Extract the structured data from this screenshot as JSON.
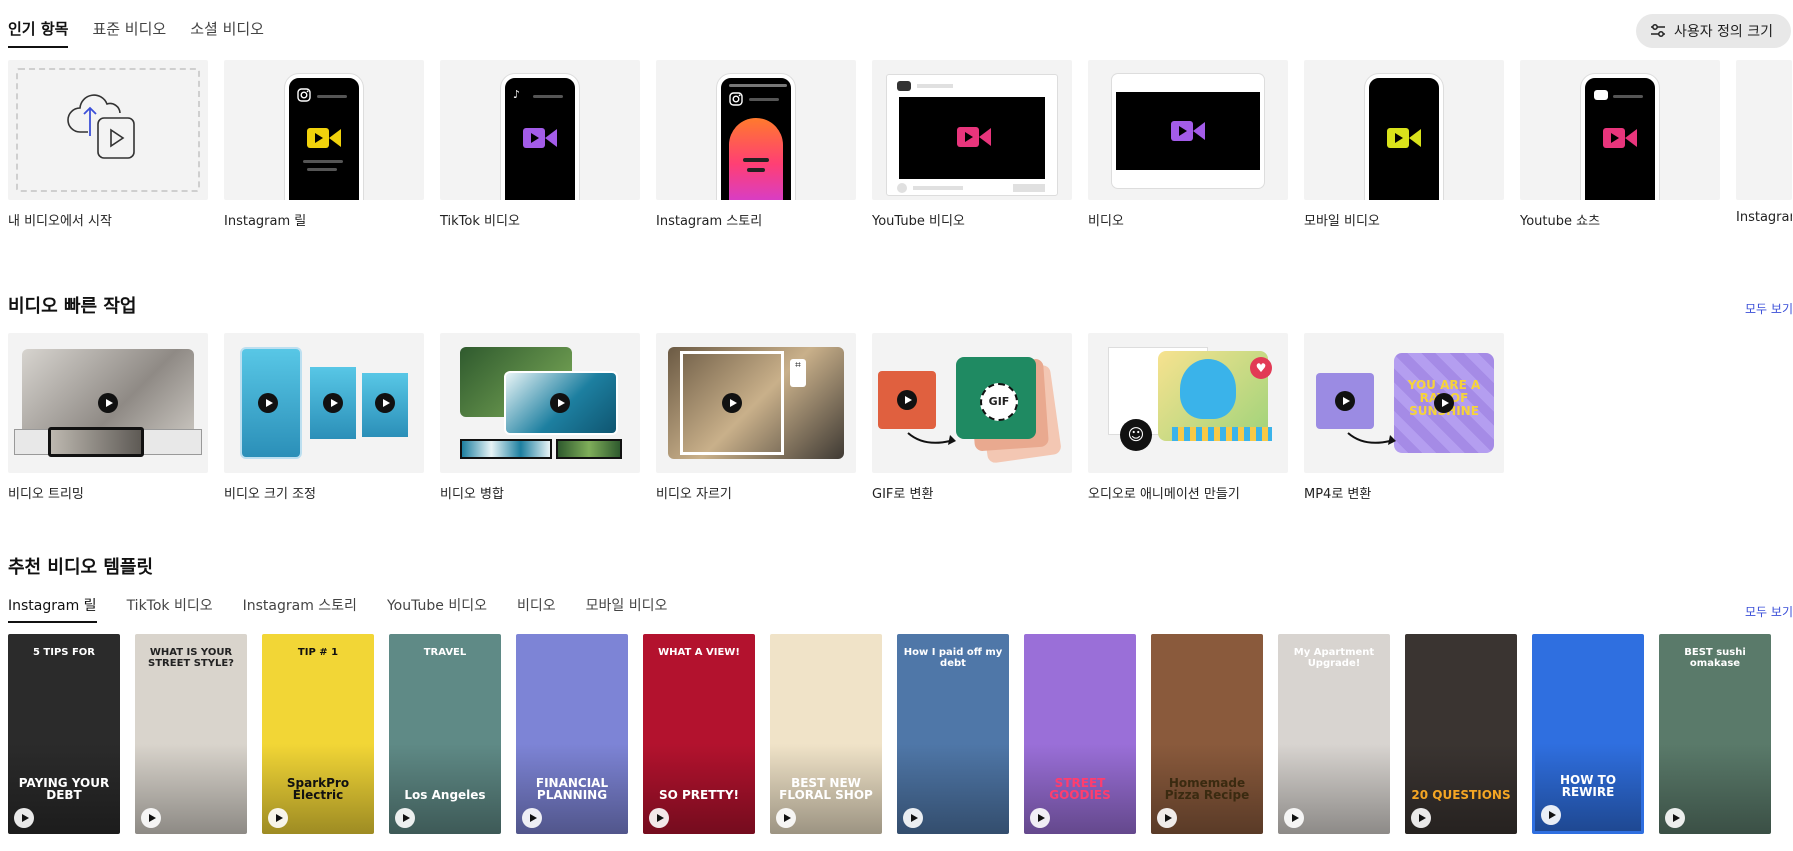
{
  "top_tabs": [
    {
      "label": "인기 항목",
      "active": true
    },
    {
      "label": "표준 비디오",
      "active": false
    },
    {
      "label": "소셜 비디오",
      "active": false
    }
  ],
  "custom_size_button": {
    "label": "사용자 정의 크기",
    "icon": "sliders-icon"
  },
  "formats": [
    {
      "label": "내 비디오에서 시작",
      "icon": "upload-video-icon"
    },
    {
      "label": "Instagram 릴",
      "icon": "instagram-icon",
      "accent": "#f1d20c"
    },
    {
      "label": "TikTok 비디오",
      "icon": "tiktok-icon",
      "accent": "#a35ce8"
    },
    {
      "label": "Instagram 스토리",
      "icon": "instagram-icon",
      "accent": "#ff5a4f"
    },
    {
      "label": "YouTube 비디오",
      "icon": "youtube-icon",
      "accent": "#e8357c"
    },
    {
      "label": "비디오",
      "icon": "video-camera-icon",
      "accent": "#a35ce8"
    },
    {
      "label": "모바일 비디오",
      "icon": "video-camera-icon",
      "accent": "#d9e21b"
    },
    {
      "label": "Youtube 쇼츠",
      "icon": "youtube-icon",
      "accent": "#e8357c"
    },
    {
      "label": "Instagram",
      "icon": "instagram-icon",
      "accent": "#cccccc"
    }
  ],
  "quick_actions": {
    "title": "비디오 빠른 작업",
    "see_all": "모두 보기",
    "items": [
      {
        "label": "비디오 트리밍"
      },
      {
        "label": "비디오 크기 조정"
      },
      {
        "label": "비디오 병합"
      },
      {
        "label": "비디오 자르기"
      },
      {
        "label": "GIF로 변환",
        "badge": "GIF"
      },
      {
        "label": "오디오로 애니메이션 만들기"
      },
      {
        "label": "MP4로 변환"
      }
    ]
  },
  "templates": {
    "title": "추천 비디오 템플릿",
    "see_all": "모두 보기",
    "tabs": [
      {
        "label": "Instagram 릴",
        "active": true
      },
      {
        "label": "TikTok 비디오",
        "active": false
      },
      {
        "label": "Instagram 스토리",
        "active": false
      },
      {
        "label": "YouTube 비디오",
        "active": false
      },
      {
        "label": "비디오",
        "active": false
      },
      {
        "label": "모바일 비디오",
        "active": false
      }
    ],
    "cards": [
      {
        "bg": "#2b2b2b",
        "text_top": "5 TIPS FOR",
        "text_bottom": "PAYING YOUR DEBT",
        "fg": "#ffffff"
      },
      {
        "bg": "#d9d4cc",
        "text_top": "WHAT IS YOUR STREET STYLE?",
        "text_bottom": "",
        "fg": "#222222"
      },
      {
        "bg": "#f2d636",
        "text_top": "TIP # 1",
        "text_bottom": "SparkPro Electric",
        "fg": "#111111"
      },
      {
        "bg": "#5f8a86",
        "text_top": "TRAVEL",
        "text_bottom": "Los Angeles",
        "fg": "#ffffff"
      },
      {
        "bg": "#7d84d6",
        "text_top": "",
        "text_bottom": "FINANCIAL PLANNING",
        "fg": "#ffffff"
      },
      {
        "bg": "#b3122e",
        "text_top": "WHAT A VIEW!",
        "text_bottom": "SO PRETTY!",
        "fg": "#ffffff"
      },
      {
        "bg": "#f0e3c8",
        "text_top": "",
        "text_bottom": "BEST NEW FLORAL SHOP",
        "fg": "#ffffff"
      },
      {
        "bg": "#4f77a8",
        "text_top": "How I paid off my debt",
        "text_bottom": "",
        "fg": "#ffffff"
      },
      {
        "bg": "#9a6fd8",
        "text_top": "",
        "text_bottom": "STREET GOODIES",
        "fg": "#ff3d6e"
      },
      {
        "bg": "#8a5a3c",
        "text_top": "",
        "text_bottom": "Homemade Pizza Recipe",
        "fg": "#3a2a10"
      },
      {
        "bg": "#d8d4d0",
        "text_top": "My Apartment Upgrade!",
        "text_bottom": "",
        "fg": "#ffffff"
      },
      {
        "bg": "#3a3431",
        "text_top": "",
        "text_bottom": "20 QUESTIONS",
        "fg": "#f5a623"
      },
      {
        "bg": "#2f6fe0",
        "text_top": "",
        "text_bottom": "HOW TO REWIRE",
        "fg": "#ffffff"
      },
      {
        "bg": "#5a7a6a",
        "text_top": "BEST sushi omakase",
        "text_bottom": "",
        "fg": "#ffffff"
      }
    ]
  }
}
